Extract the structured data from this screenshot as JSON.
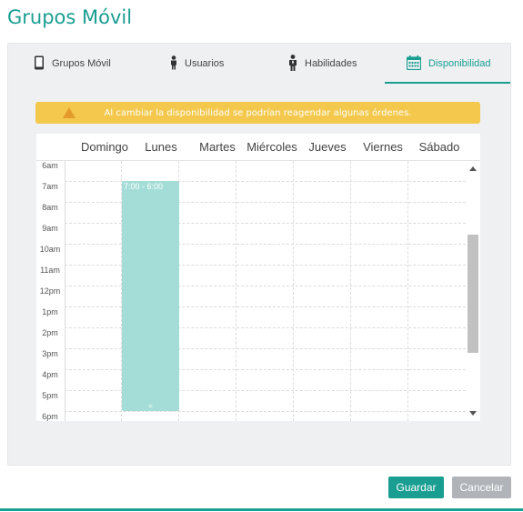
{
  "window": {
    "title": "Grupos Móvil"
  },
  "tabs": [
    {
      "label": "Grupos Móvil",
      "icon": "mobile-phone-icon"
    },
    {
      "label": "Usuarios",
      "icon": "user-icon"
    },
    {
      "label": "Habilidades",
      "icon": "person-tie-icon"
    },
    {
      "label": "Disponibilidad",
      "icon": "calendar-icon",
      "active": true
    }
  ],
  "alert": {
    "text": "Al cambiar la disponibilidad se podrían reagendar algunas órdenes.",
    "icon": "warning-icon"
  },
  "calendar": {
    "days": [
      "Domingo",
      "Lunes",
      "Martes",
      "Miércoles",
      "Jueves",
      "Viernes",
      "Sábado"
    ],
    "times": [
      "6am",
      "7am",
      "8am",
      "9am",
      "10am",
      "11am",
      "12pm",
      "1pm",
      "2pm",
      "3pm",
      "4pm",
      "5pm",
      "6pm"
    ],
    "event": {
      "day": "Lunes",
      "label": "7:00 - 6:00",
      "handle": "="
    }
  },
  "buttons": {
    "save_label": "Guardar",
    "cancel_label": "Cancelar"
  },
  "colors": {
    "accent": "#1a9e92",
    "alert_bg": "#f3c84c",
    "event_bg": "#a4ddd7",
    "cancel_bg": "#b0b4b8"
  }
}
